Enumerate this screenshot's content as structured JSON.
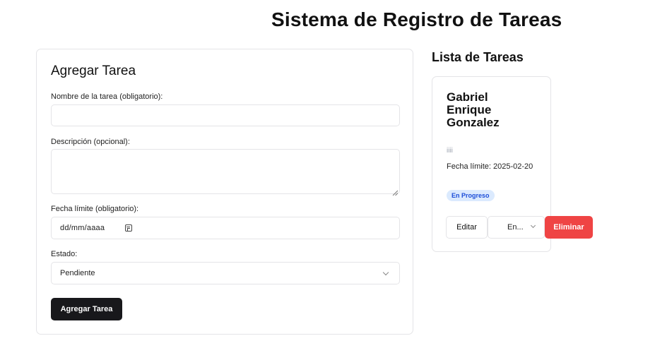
{
  "header": {
    "title": "Sistema de Registro de Tareas"
  },
  "form": {
    "title": "Agregar Tarea",
    "name_label": "Nombre de la tarea (obligatorio):",
    "name_value": "",
    "description_label": "Descripción (opcional):",
    "description_value": "",
    "due_label": "Fecha límite (obligatorio):",
    "due_placeholder": "dd/mm/aaaa",
    "status_label": "Estado:",
    "status_value": "Pendiente",
    "submit_label": "Agregar Tarea"
  },
  "list": {
    "title": "Lista de Tareas",
    "tasks": [
      {
        "name": "Gabriel Enrique Gonzalez",
        "description": "iiii",
        "due": "Fecha límite: 2025-02-20",
        "status_badge": "En Progreso",
        "status_badge_colors": {
          "bg": "#dbeafe",
          "fg": "#1d4ed8"
        },
        "edit_label": "Editar",
        "state_select_value": "En...",
        "delete_label": "Eliminar",
        "delete_color": "#ef4444"
      }
    ]
  },
  "icons": {
    "calendar": "calendar-icon",
    "chevron": "chevron-down-icon",
    "resize": "resize-grip-icon"
  },
  "colors": {
    "primary_button": "#18181b",
    "border": "#e4e4e7"
  }
}
